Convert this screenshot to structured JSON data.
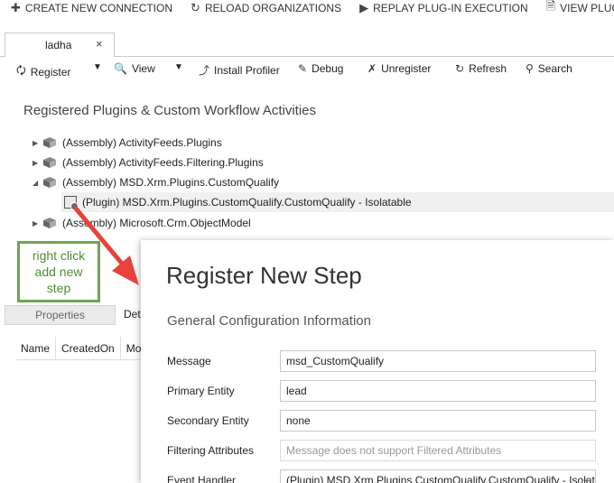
{
  "topbar": {
    "create_connection": "CREATE NEW CONNECTION",
    "reload_orgs": "RELOAD ORGANIZATIONS",
    "replay": "REPLAY PLUG-IN EXECUTION",
    "view_plugin": "VIEW PLUG-IN"
  },
  "tab": {
    "label": "ladha",
    "close": "×"
  },
  "toolbar": {
    "register": "Register",
    "view": "View",
    "install_profiler": "Install Profiler",
    "debug": "Debug",
    "unregister": "Unregister",
    "refresh": "Refresh",
    "search": "Search"
  },
  "section_title": "Registered Plugins & Custom Workflow Activities",
  "tree": [
    {
      "label": "(Assembly) ActivityFeeds.Plugins",
      "expanded": false
    },
    {
      "label": "(Assembly) ActivityFeeds.Filtering.Plugins",
      "expanded": false
    },
    {
      "label": "(Assembly) MSD.Xrm.Plugins.CustomQualify",
      "expanded": true
    },
    {
      "label": "(Plugin) MSD.Xrm.Plugins.CustomQualify.CustomQualify - Isolatable",
      "expanded": false
    },
    {
      "label": "(Assembly) Microsoft.Crm.ObjectModel",
      "expanded": false
    }
  ],
  "callout": {
    "line1": "right click",
    "line2": "add new",
    "line3": "step",
    "color": "#6aa84f"
  },
  "lower_panel": {
    "tab_properties": "Properties",
    "tab_details": "Det",
    "columns": [
      "Name",
      "CreatedOn",
      "Mod"
    ]
  },
  "dialog": {
    "title": "Register New Step",
    "subtitle": "General Configuration Information",
    "fields": {
      "message_label": "Message",
      "message_value": "msd_CustomQualify",
      "primary_label": "Primary Entity",
      "primary_value": "lead",
      "secondary_label": "Secondary Entity",
      "secondary_value": "none",
      "filtering_label": "Filtering Attributes",
      "filtering_placeholder": "Message does not support Filtered Attributes",
      "handler_label": "Event Handler",
      "handler_value": "(Plugin) MSD.Xrm.Plugins.CustomQualify.CustomQualify - Isolatable"
    }
  },
  "colors": {
    "arrow": "#e8423a",
    "callout_border": "#6aa84f"
  }
}
